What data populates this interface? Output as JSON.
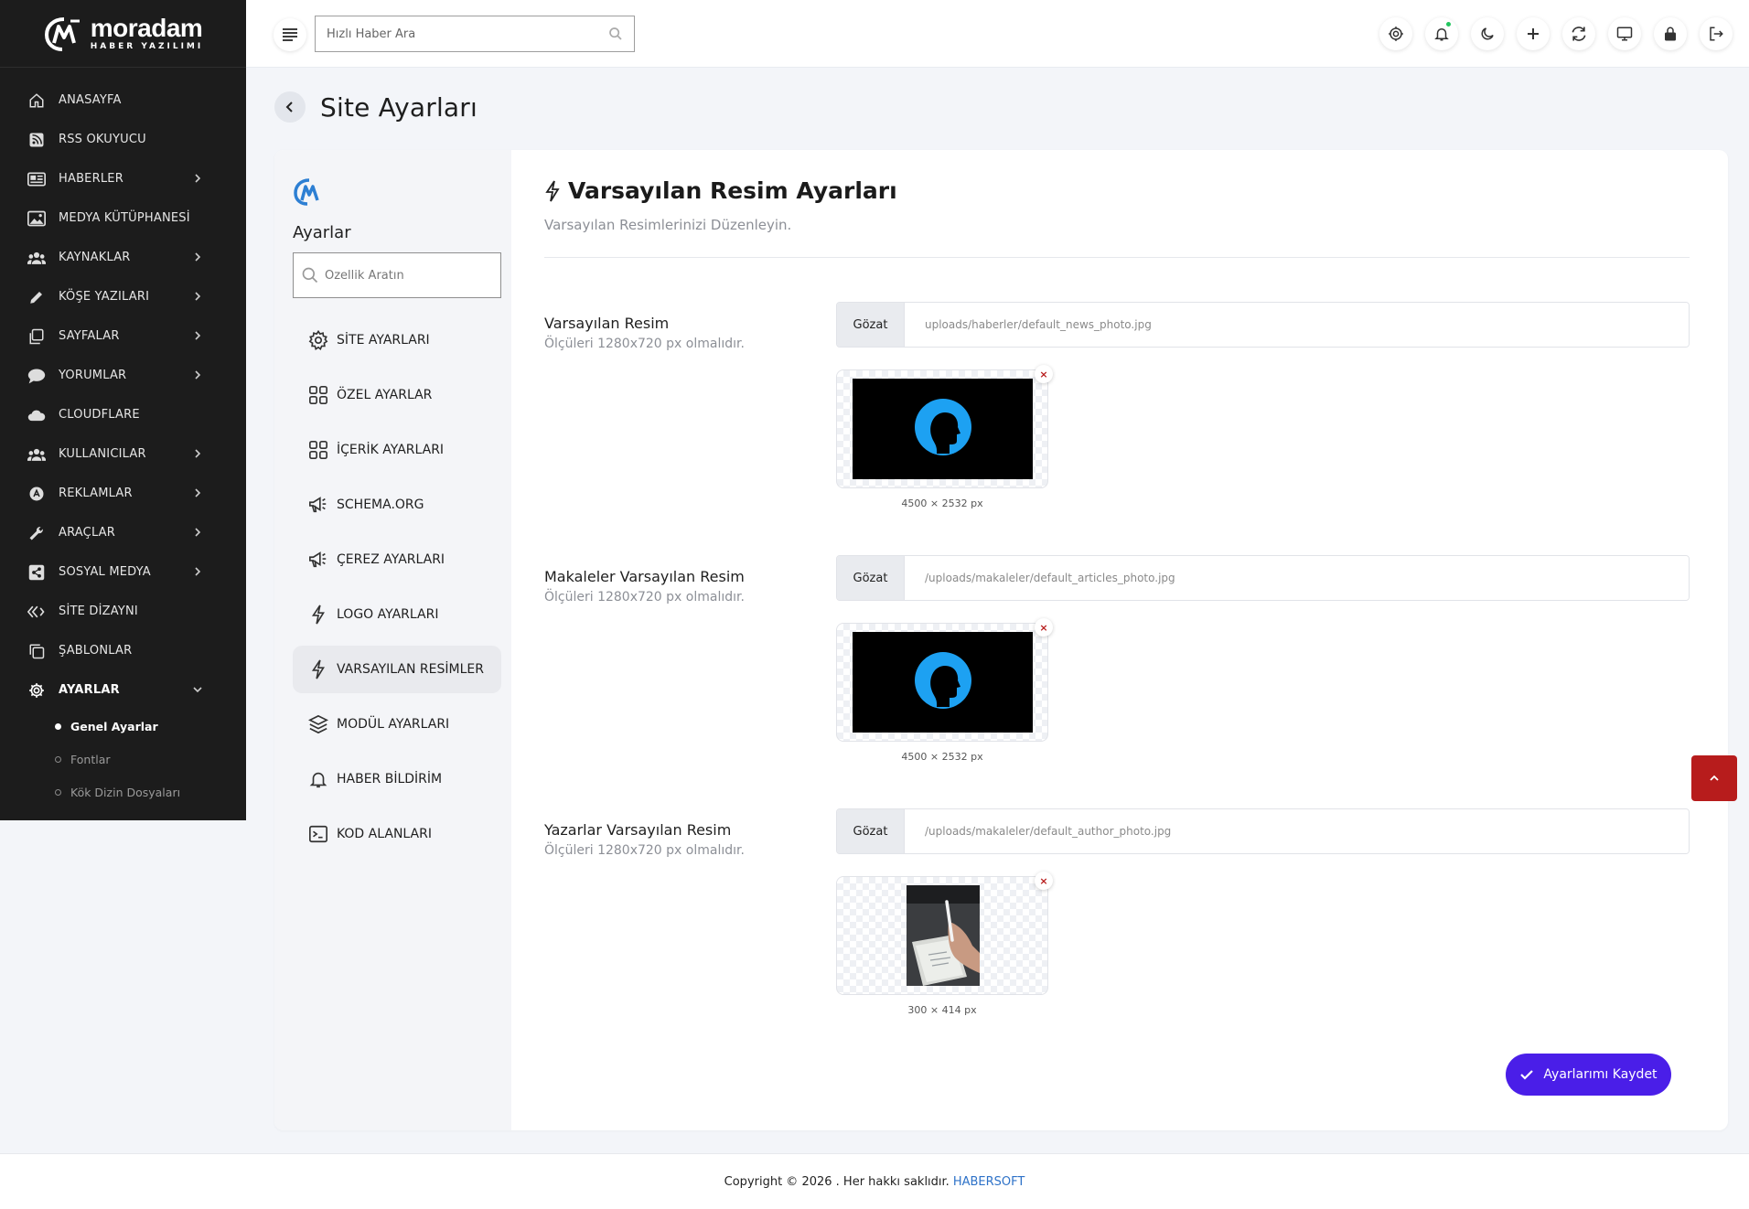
{
  "brand": {
    "name": "moradam",
    "tagline": "HABER YAZILIMI"
  },
  "sidebar": {
    "items": [
      {
        "label": "ANASAYFA",
        "icon": "home-icon",
        "has_children": false
      },
      {
        "label": "RSS OKUYUCU",
        "icon": "rss-icon",
        "has_children": false
      },
      {
        "label": "HABERLER",
        "icon": "newspaper-icon",
        "has_children": true
      },
      {
        "label": "MEDYA KÜTÜPHANESİ",
        "icon": "image-icon",
        "has_children": false
      },
      {
        "label": "KAYNAKLAR",
        "icon": "users-icon",
        "has_children": true
      },
      {
        "label": "KÖŞE YAZILARI",
        "icon": "pen-icon",
        "has_children": true
      },
      {
        "label": "SAYFALAR",
        "icon": "pages-icon",
        "has_children": true
      },
      {
        "label": "YORUMLAR",
        "icon": "comment-icon",
        "has_children": true
      },
      {
        "label": "CLOUDFLARE",
        "icon": "cloud-icon",
        "has_children": false
      },
      {
        "label": "KULLANICILAR",
        "icon": "users-icon",
        "has_children": true
      },
      {
        "label": "REKLAMLAR",
        "icon": "ads-icon",
        "has_children": true
      },
      {
        "label": "ARAÇLAR",
        "icon": "wrench-icon",
        "has_children": true
      },
      {
        "label": "SOSYAL MEDYA",
        "icon": "share-icon",
        "has_children": true
      },
      {
        "label": "SİTE DİZAYNI",
        "icon": "design-icon",
        "has_children": false
      },
      {
        "label": "ŞABLONLAR",
        "icon": "copy-icon",
        "has_children": false
      },
      {
        "label": "AYARLAR",
        "icon": "gear-icon",
        "has_children": true,
        "expanded": true
      }
    ],
    "subitems": [
      {
        "label": "Genel Ayarlar",
        "current": true
      },
      {
        "label": "Fontlar",
        "current": false
      },
      {
        "label": "Kök Dizin Dosyaları",
        "current": false
      }
    ]
  },
  "topbar": {
    "search_placeholder": "Hızlı Haber Ara",
    "actions": [
      "gear-icon",
      "bell-icon",
      "moon-icon",
      "plus-icon",
      "refresh-icon",
      "monitor-icon",
      "lock-icon",
      "logout-icon"
    ]
  },
  "page": {
    "title": "Site Ayarları"
  },
  "settings_nav": {
    "title": "Ayarlar",
    "search_placeholder": "Özellik Aratın",
    "items": [
      {
        "label": "SİTE AYARLARI",
        "icon": "gear-icon",
        "active": false
      },
      {
        "label": "ÖZEL AYARLAR",
        "icon": "grid-icon",
        "active": false
      },
      {
        "label": "İÇERİK AYARLARI",
        "icon": "grid-icon",
        "active": false
      },
      {
        "label": "SCHEMA.ORG",
        "icon": "megaphone-icon",
        "active": false
      },
      {
        "label": "ÇEREZ AYARLARI",
        "icon": "megaphone-icon",
        "active": false
      },
      {
        "label": "LOGO AYARLARI",
        "icon": "bolt-icon",
        "active": false
      },
      {
        "label": "VARSAYILAN RESİMLER",
        "icon": "bolt-icon",
        "active": true
      },
      {
        "label": "MODÜL AYARLARI",
        "icon": "layers-icon",
        "active": false
      },
      {
        "label": "HABER BİLDİRİM",
        "icon": "bell-icon",
        "active": false
      },
      {
        "label": "KOD ALANLARI",
        "icon": "terminal-icon",
        "active": false
      }
    ]
  },
  "section": {
    "title": "Varsayılan Resim Ayarları",
    "subtitle": "Varsayılan Resimlerinizi Düzenleyin."
  },
  "fields": [
    {
      "label": "Varsayılan Resim",
      "hint": "Ölçüleri 1280x720 px olmalıdır.",
      "browse": "Gözat",
      "path": "uploads/haberler/default_news_photo.jpg",
      "dims": "4500 × 2532 px",
      "remove": "×"
    },
    {
      "label": "Makaleler Varsayılan Resim",
      "hint": "Ölçüleri 1280x720 px olmalıdır.",
      "browse": "Gözat",
      "path": "/uploads/makaleler/default_articles_photo.jpg",
      "dims": "4500 × 2532 px",
      "remove": "×"
    },
    {
      "label": "Yazarlar Varsayılan Resim",
      "hint": "Ölçüleri 1280x720 px olmalıdır.",
      "browse": "Gözat",
      "path": "/uploads/makaleler/default_author_photo.jpg",
      "dims": "300 × 414 px",
      "remove": "×"
    }
  ],
  "save_button": {
    "label": "Ayarlarımı Kaydet"
  },
  "footer": {
    "text": "Copyright © 2026 . Her hakkı saklıdır.",
    "link": "HABERSOFT"
  },
  "colors": {
    "accent": "#4a1ee8",
    "danger": "#b71c1c",
    "sidebar_bg": "#1c1c1c",
    "link": "#2e72c8"
  }
}
